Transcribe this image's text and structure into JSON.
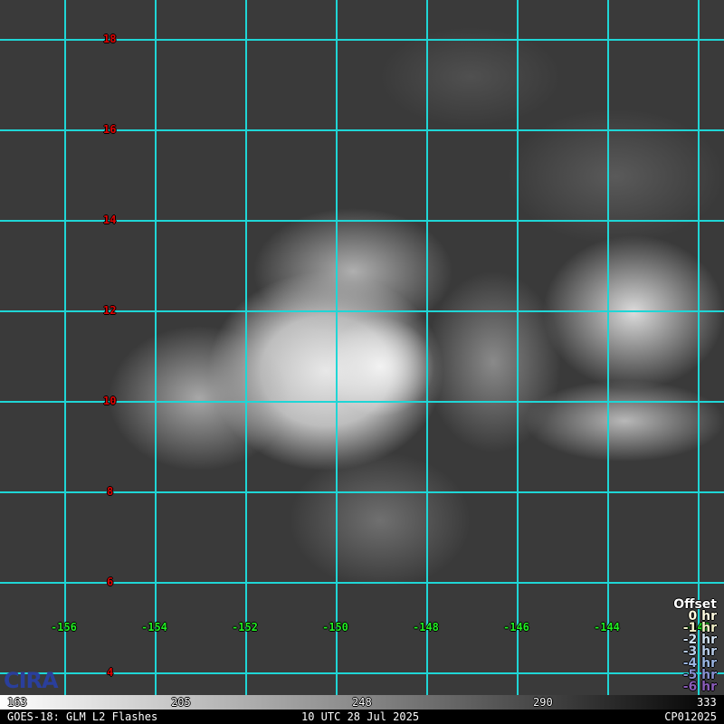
{
  "map": {
    "lat_labels": [
      "18",
      "16",
      "14",
      "12",
      "10",
      "8",
      "6",
      "4"
    ],
    "lon_labels": [
      "-156",
      "-154",
      "-152",
      "-150",
      "-148",
      "-146",
      "-144",
      "-142"
    ],
    "grid_color": "#1fd6d6"
  },
  "legend": {
    "title": "Offset",
    "items": [
      {
        "label": "0 hr",
        "color": "#fffbe0"
      },
      {
        "label": "-1 hr",
        "color": "#f2f0c8"
      },
      {
        "label": "-2 hr",
        "color": "#d0e0f0"
      },
      {
        "label": "-3 hr",
        "color": "#b8cce8"
      },
      {
        "label": "-4 hr",
        "color": "#9ab4e0"
      },
      {
        "label": "-5 hr",
        "color": "#8a90d0"
      },
      {
        "label": "-6 hr",
        "color": "#8a5cb8"
      }
    ]
  },
  "colorbar": {
    "ticks": [
      "163",
      "205",
      "248",
      "290",
      "333"
    ]
  },
  "footer": {
    "left": "GOES-18: GLM L2 Flashes",
    "center": "10 UTC 28 Jul 2025",
    "right": "CP012025"
  },
  "logo": "CIRA"
}
